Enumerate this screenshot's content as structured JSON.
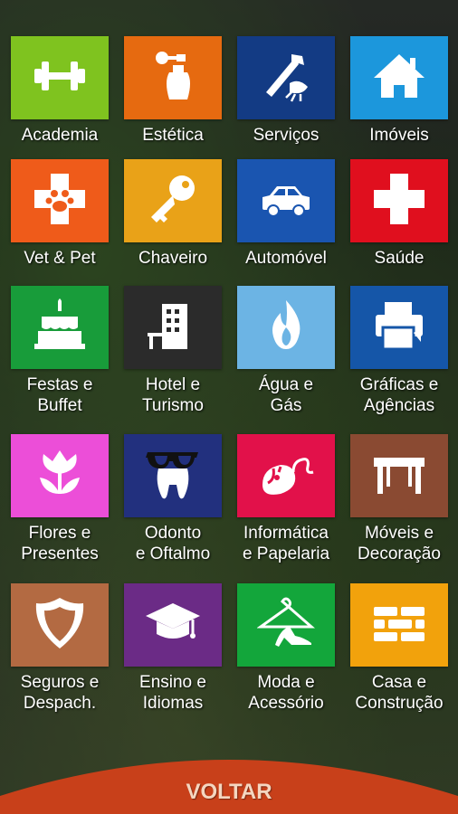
{
  "tiles": [
    {
      "label": "Academia",
      "icon": "dumbbell-icon",
      "color": "#7fc31f"
    },
    {
      "label": "Estética",
      "icon": "perfume-icon",
      "color": "#e66a10"
    },
    {
      "label": "Serviços",
      "icon": "tools-icon",
      "color": "#133b84"
    },
    {
      "label": "Imóveis",
      "icon": "house-icon",
      "color": "#1c97dc"
    },
    {
      "label": "Vet & Pet",
      "icon": "paw-cross-icon",
      "color": "#ef5b1a"
    },
    {
      "label": "Chaveiro",
      "icon": "key-icon",
      "color": "#e9a218"
    },
    {
      "label": "Automóvel",
      "icon": "car-icon",
      "color": "#1a55b0"
    },
    {
      "label": "Saúde",
      "icon": "health-cross-icon",
      "color": "#e00f1e"
    },
    {
      "label": "Festas e\nBuffet",
      "icon": "cake-icon",
      "color": "#189c3a"
    },
    {
      "label": "Hotel e\nTurismo",
      "icon": "hotel-icon",
      "color": "#2b2b2b"
    },
    {
      "label": "Água e\nGás",
      "icon": "flame-icon",
      "color": "#6cb4e4"
    },
    {
      "label": "Gráficas e\nAgências",
      "icon": "printer-icon",
      "color": "#1556a8"
    },
    {
      "label": "Flores e\nPresentes",
      "icon": "tulip-icon",
      "color": "#ec4ed8"
    },
    {
      "label": "Odonto\ne Oftalmo",
      "icon": "tooth-glasses-icon",
      "color": "#22307e"
    },
    {
      "label": "Informática\ne Papelaria",
      "icon": "mouse-icon",
      "color": "#e2114a"
    },
    {
      "label": "Móveis e\nDecoração",
      "icon": "table-icon",
      "color": "#8a4a32"
    },
    {
      "label": "Seguros e\nDespach.",
      "icon": "shield-icon",
      "color": "#b36a42"
    },
    {
      "label": "Ensino e\nIdiomas",
      "icon": "graduation-cap-icon",
      "color": "#6b2b86"
    },
    {
      "label": "Moda e\nAcessório",
      "icon": "hanger-heel-icon",
      "color": "#13a63b"
    },
    {
      "label": "Casa e\nConstrução",
      "icon": "bricks-icon",
      "color": "#f2a20c"
    }
  ],
  "back_button": {
    "label": "VOLTAR",
    "color": "#c8401a"
  }
}
